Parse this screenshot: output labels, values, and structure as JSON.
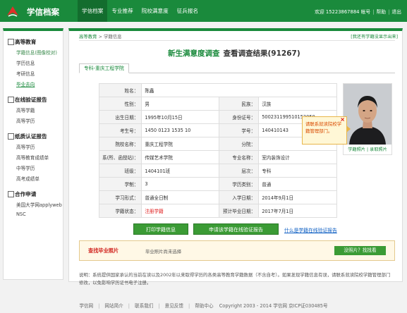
{
  "header": {
    "brand": "学信档案",
    "nav": [
      "学信档案",
      "专业推荐",
      "院校满意度",
      "征兵报名"
    ],
    "welcome": "欢迎 15223867884 帐号",
    "help": "帮助",
    "logout": "退出"
  },
  "sidebar": {
    "groups": [
      {
        "title": "高等教育",
        "items": [
          "学籍信息(图像校对)",
          "学历信息",
          "考研信息",
          "毕业去向"
        ]
      },
      {
        "title": "在线验证报告",
        "items": [
          "高等学籍",
          "高等学历"
        ]
      },
      {
        "title": "纸质认证报告",
        "items": [
          "高等学历",
          "高等教育成绩单",
          "中等学历",
          "高考成绩单"
        ]
      },
      {
        "title": "合作申请",
        "items": [
          "美国大学网applyweb",
          "NSC"
        ]
      }
    ]
  },
  "main": {
    "breadcrumb_home": "高等教育",
    "breadcrumb_sep": ">",
    "breadcrumb_current": "学籍信息",
    "feedback": "[我还有学籍没显示出来]",
    "survey": "新生满意度调查",
    "survey_result": "查看调查结果(91267)",
    "tab": "专科-重庆工程学院",
    "fields": {
      "name_label": "姓名：",
      "name": "陈鑫",
      "gender_label": "性别：",
      "gender": "男",
      "ethnic_label": "民族：",
      "ethnic": "汉族",
      "birth_label": "出生日期：",
      "birth": "1995年10月15日",
      "id_label": "身份证号：",
      "id": "500231199510152050",
      "exam_label": "考生号：",
      "exam": "1450 0123 1535 10",
      "sid_label": "学号：",
      "sid": "140410143",
      "school_label": "院校名称：",
      "school": "重庆工程学院",
      "branch_label": "分院：",
      "branch": "",
      "dept_label": "系(所、函授站)：",
      "dept": "传媒艺术学院",
      "major_label": "专业名称：",
      "major": "室内装饰设计",
      "class_label": "班级：",
      "class": "1404101班",
      "level_label": "层次：",
      "level": "专科",
      "length_label": "学制：",
      "length": "3",
      "type_label": "学历类别：",
      "type": "普通",
      "form_label": "学习形式：",
      "form": "普通全日制",
      "enroll_label": "入学日期：",
      "enroll": "2014年9月1日",
      "status_label": "学籍状态：",
      "status": "注册学籍",
      "grad_label": "预计毕业日期：",
      "grad": "2017年7月1日"
    },
    "photo_caption_1": "学籍照片",
    "photo_caption_2": "录取照片",
    "tooltip": "请联系就读院校学籍管理部门。",
    "tooltip_close": "×",
    "print_btn": "打印学籍信息",
    "apply_btn": "申请该学籍在线验证报告",
    "help_link": "什么是学籍在线验证报告",
    "find_title": "查找毕业照片",
    "find_text": "毕业照片尚未选择",
    "find_btn": "没照片？找找看",
    "note": "说明：系统提供国家承认的当前在读以及2002年以来取得学历的各类高等教育学籍数据（不含自考）。如果发现学籍信息有误，请联系就读院校学籍管理部门修改，以免影响学历证书电子注册。"
  },
  "footer": [
    "学信网",
    "网站简介",
    "联系我们",
    "意见反馈",
    "帮助中心",
    "Copyright 2003 - 2014  学信网  京ICP证030485号"
  ],
  "colors": {
    "brand_green": "#1a8a3c",
    "alert_red": "#e02020"
  }
}
